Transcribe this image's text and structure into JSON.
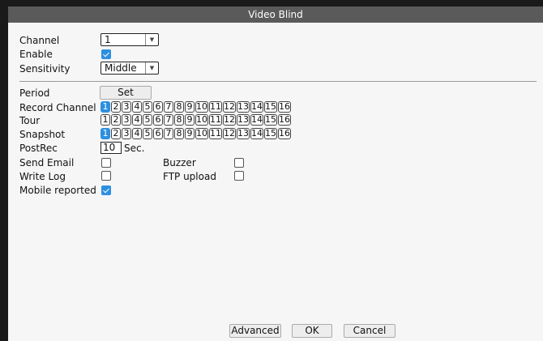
{
  "window": {
    "title": "Video Blind"
  },
  "fields": {
    "channel": {
      "label": "Channel",
      "value": "1"
    },
    "enable": {
      "label": "Enable",
      "checked": true
    },
    "sensitivity": {
      "label": "Sensitivity",
      "value": "Middle"
    },
    "period": {
      "label": "Period",
      "button": "Set"
    },
    "record_channel": {
      "label": "Record Channel",
      "selected": [
        1
      ]
    },
    "tour": {
      "label": "Tour",
      "selected": []
    },
    "snapshot": {
      "label": "Snapshot",
      "selected": [
        1
      ]
    },
    "postrec": {
      "label": "PostRec",
      "value": "10",
      "unit": "Sec."
    },
    "send_email": {
      "label": "Send Email",
      "checked": false
    },
    "buzzer": {
      "label": "Buzzer",
      "checked": false
    },
    "write_log": {
      "label": "Write Log",
      "checked": false
    },
    "ftp_upload": {
      "label": "FTP upload",
      "checked": false
    },
    "mobile_reported": {
      "label": "Mobile reported",
      "checked": true
    }
  },
  "channels": [
    "1",
    "2",
    "3",
    "4",
    "5",
    "6",
    "7",
    "8",
    "9",
    "10",
    "11",
    "12",
    "13",
    "14",
    "15",
    "16"
  ],
  "buttons": {
    "advanced": "Advanced",
    "ok": "OK",
    "cancel": "Cancel"
  },
  "colors": {
    "accent": "#2d8fe0",
    "titlebar": "#5a5a5a",
    "background": "#f6f6f6"
  }
}
